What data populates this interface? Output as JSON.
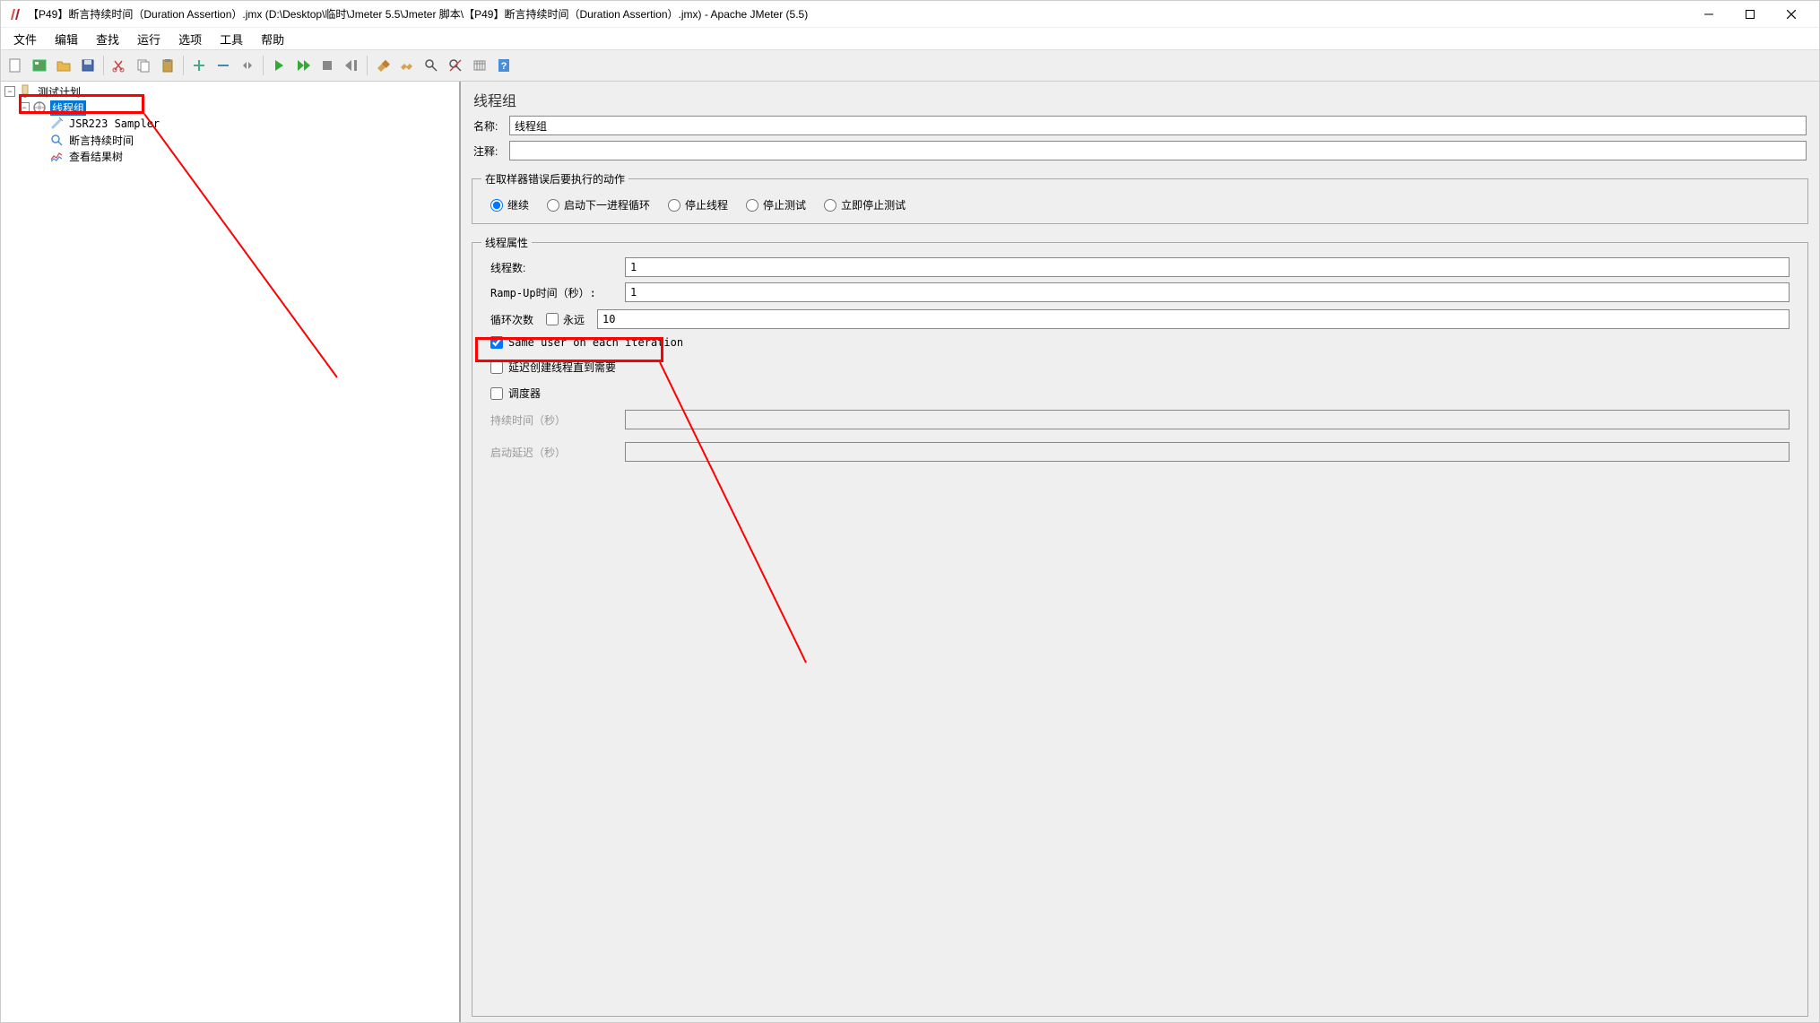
{
  "window": {
    "title": "【P49】断言持续时间（Duration Assertion）.jmx (D:\\Desktop\\临时\\Jmeter 5.5\\Jmeter 脚本\\【P49】断言持续时间（Duration Assertion）.jmx) - Apache JMeter (5.5)"
  },
  "menu": {
    "items": [
      "文件",
      "编辑",
      "查找",
      "运行",
      "选项",
      "工具",
      "帮助"
    ]
  },
  "tree": {
    "root": "测试计划",
    "node_threadgroup": "线程组",
    "node_sampler": "JSR223 Sampler",
    "node_assertion": "断言持续时间",
    "node_results": "查看结果树"
  },
  "panel": {
    "title": "线程组",
    "name_label": "名称:",
    "name_value": "线程组",
    "comment_label": "注释:",
    "comment_value": "",
    "error_action_legend": "在取样器错误后要执行的动作",
    "radio_continue": "继续",
    "radio_next_loop": "启动下一进程循环",
    "radio_stop_thread": "停止线程",
    "radio_stop_test": "停止测试",
    "radio_stop_now": "立即停止测试",
    "thread_props_legend": "线程属性",
    "threads_label": "线程数:",
    "threads_value": "1",
    "rampup_label": "Ramp-Up时间（秒）:",
    "rampup_value": "1",
    "loop_label": "循环次数",
    "loop_forever": "永远",
    "loop_value": "10",
    "same_user_label": "Same user on each iteration",
    "delay_start_label": "延迟创建线程直到需要",
    "scheduler_label": "调度器",
    "duration_label": "持续时间（秒）",
    "startup_delay_label": "启动延迟（秒）"
  },
  "colors": {
    "highlight": "#ff0000",
    "selection": "#0078d7"
  }
}
